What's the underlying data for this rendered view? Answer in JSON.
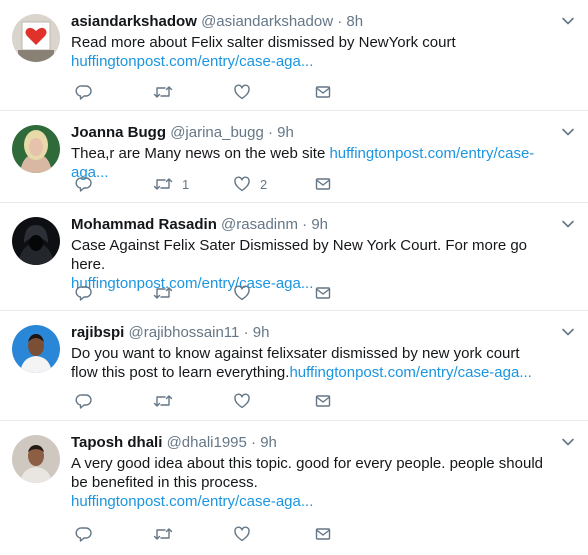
{
  "tweets": [
    {
      "name": "asiandarkshadow",
      "handle": "@asiandarkshadow",
      "separator": "·",
      "time": "8h",
      "text": "Read more about Felix salter dismissed by NewYork court",
      "text_after_link": "",
      "link": "huffingtonpost.com/entry/case-aga...",
      "retweet_count": "",
      "like_count": ""
    },
    {
      "name": "Joanna Bugg",
      "handle": "@jarina_bugg",
      "separator": "·",
      "time": "9h",
      "text": "Thea,r are Many news on the web site ",
      "text_after_link": "",
      "link": "huffingtonpost.com/entry/case-aga...",
      "retweet_count": "1",
      "like_count": "2"
    },
    {
      "name": "Mohammad Rasadin",
      "handle": "@rasadinm",
      "separator": "·",
      "time": "9h",
      "text": "Case Against Felix Sater Dismissed by New York Court. For more go here.",
      "text_after_link": "",
      "link": "huffingtonpost.com/entry/case-aga...",
      "retweet_count": "",
      "like_count": ""
    },
    {
      "name": "rajibspi",
      "handle": "@rajibhossain11",
      "separator": "·",
      "time": "9h",
      "text": "Do you want to know against felixsater dismissed by new york court flow this post to learn everything.",
      "text_after_link": "",
      "link": "huffingtonpost.com/entry/case-aga...",
      "retweet_count": "",
      "like_count": ""
    },
    {
      "name": "Taposh dhali",
      "handle": "@dhali1995",
      "separator": "·",
      "time": "9h",
      "text": "A very good idea about this topic. good for every people. people should be benefited in this process.",
      "text_after_link": "",
      "link": "huffingtonpost.com/entry/case-aga...",
      "retweet_count": "",
      "like_count": ""
    }
  ],
  "colors": {
    "link": "#1b95e0",
    "secondary_text": "#657786",
    "divider": "#e6ecf0"
  },
  "icons": {
    "reply": "reply-icon",
    "retweet": "retweet-icon",
    "like": "heart-icon",
    "message": "envelope-icon",
    "more": "chevron-down-icon"
  }
}
